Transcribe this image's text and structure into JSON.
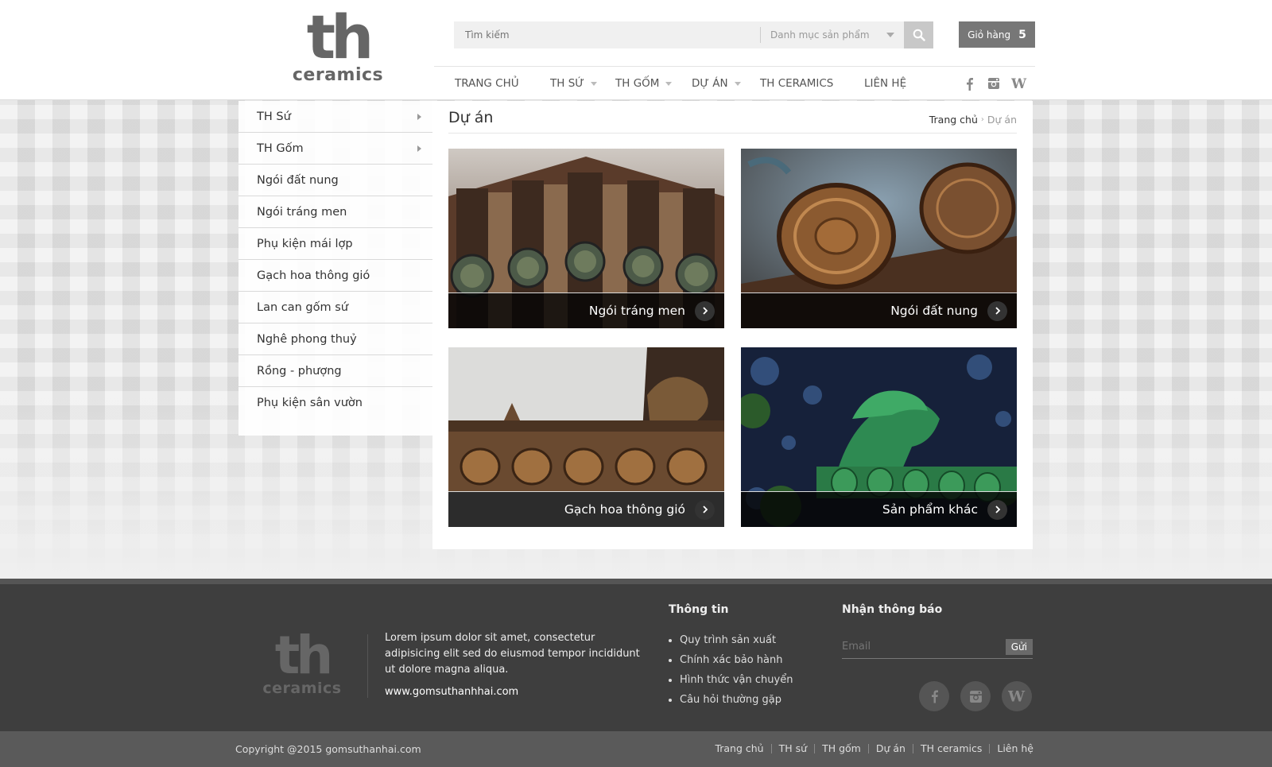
{
  "header": {
    "logo": {
      "mark": "th",
      "word": "ceramics"
    },
    "search": {
      "placeholder": "Tìm kiếm",
      "category": "Danh mục sản phẩm"
    },
    "cart": {
      "label": "Giỏ hàng",
      "count": "5"
    },
    "nav": [
      {
        "label": "TRANG CHỦ",
        "dropdown": false
      },
      {
        "label": "TH SỨ",
        "dropdown": true
      },
      {
        "label": "TH GỐM",
        "dropdown": true
      },
      {
        "label": "DỰ ÁN",
        "dropdown": true
      },
      {
        "label": "TH CERAMICS",
        "dropdown": false
      },
      {
        "label": "LIÊN HỆ",
        "dropdown": false
      }
    ],
    "social": [
      "facebook-icon",
      "instagram-icon",
      "wordpress-icon"
    ]
  },
  "sidebar": {
    "items": [
      {
        "label": "TH Sứ",
        "submenu": true
      },
      {
        "label": "TH Gốm",
        "submenu": true
      },
      {
        "label": "Ngói đất nung",
        "submenu": false
      },
      {
        "label": "Ngói tráng men",
        "submenu": false
      },
      {
        "label": "Phụ kiện mái lợp",
        "submenu": false
      },
      {
        "label": "Gạch hoa thông gió",
        "submenu": false
      },
      {
        "label": "Lan can gốm sứ",
        "submenu": false
      },
      {
        "label": "Nghê phong thuỷ",
        "submenu": false
      },
      {
        "label": "Rồng - phượng",
        "submenu": false
      },
      {
        "label": "Phụ kiện sân vườn",
        "submenu": false
      }
    ]
  },
  "main": {
    "title": "Dự án",
    "breadcrumb": {
      "home": "Trang chủ",
      "current": "Dự án"
    },
    "cards": [
      {
        "label": "Ngói tráng men"
      },
      {
        "label": "Ngói đất nung"
      },
      {
        "label": "Gạch hoa thông gió"
      },
      {
        "label": "Sản phẩm khác"
      }
    ]
  },
  "footer": {
    "logo": {
      "mark": "th",
      "word": "ceramics"
    },
    "about": "Lorem ipsum dolor sit amet, consectetur adipisicing elit sed do eiusmod tempor incididunt ut dolore magna aliqua.",
    "website": "www.gomsuthanhhai.com",
    "info_title": "Thông tin",
    "info_links": [
      "Quy trình sản xuất",
      "Chính xác bảo hành",
      "Hình thức vận chuyển",
      "Câu hỏi thường gặp"
    ],
    "newsletter_title": "Nhận thông báo",
    "email_placeholder": "Email",
    "send_label": "Gửi",
    "social": [
      "facebook-icon",
      "instagram-icon",
      "wordpress-icon"
    ]
  },
  "bottom": {
    "copyright": "Copyright @2015 gomsuthanhai.com",
    "links": [
      "Trang chủ",
      "TH sứ",
      "TH gốm",
      "Dự án",
      "TH ceramics",
      "Liên hệ"
    ]
  }
}
